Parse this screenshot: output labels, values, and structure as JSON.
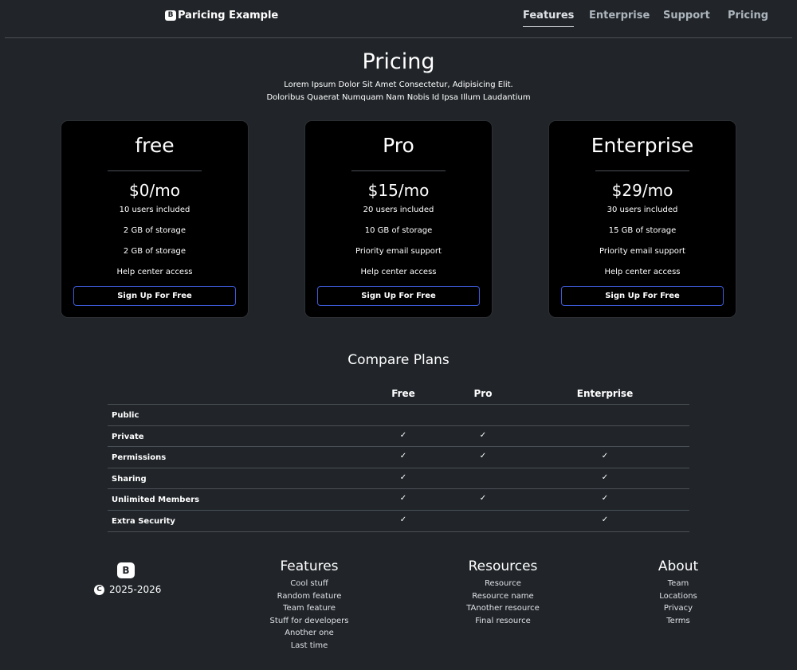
{
  "navbar": {
    "brand_logo": "B",
    "brand": "Paricing Example",
    "links": [
      {
        "label": "Features",
        "active": true
      },
      {
        "label": "Enterprise"
      },
      {
        "label": "Support"
      },
      {
        "label": "Pricing"
      }
    ]
  },
  "header": {
    "title": "Pricing",
    "subtitle_line1": "Lorem Ipsum Dolor Sit Amet Consectetur, Adipisicing Elit.",
    "subtitle_line2": "Doloribus Quaerat Numquam Nam Nobis Id Ipsa Illum Laudantium"
  },
  "plans": [
    {
      "name": "free",
      "price": "$0/mo",
      "features": [
        "10 users included",
        "2 GB of storage",
        "2 GB of storage",
        "Help center access"
      ],
      "button": "Sign Up For Free"
    },
    {
      "name": "Pro",
      "price": "$15/mo",
      "features": [
        "20 users included",
        "10 GB of storage",
        "Priority email support",
        "Help center access"
      ],
      "button": "Sign Up For Free"
    },
    {
      "name": "Enterprise",
      "price": "$29/mo",
      "features": [
        "30 users included",
        "15 GB of storage",
        "Priority email support",
        "Help center access"
      ],
      "button": "Sign Up For Free"
    }
  ],
  "compare": {
    "title": "Compare Plans",
    "columns": [
      "Free",
      "Pro",
      "Enterprise"
    ],
    "check_glyph": "✓",
    "rows": [
      {
        "label": "Public",
        "checks": [
          false,
          false,
          false
        ]
      },
      {
        "label": "Private",
        "checks": [
          true,
          true,
          false
        ]
      },
      {
        "label": "Permissions",
        "checks": [
          true,
          true,
          true
        ]
      },
      {
        "label": "Sharing",
        "checks": [
          true,
          false,
          true
        ]
      },
      {
        "label": "Unlimited Members",
        "checks": [
          true,
          true,
          true
        ]
      },
      {
        "label": "Extra Security",
        "checks": [
          true,
          false,
          true
        ]
      }
    ]
  },
  "footer": {
    "logo": "B",
    "copyright_symbol": "C",
    "years": "2025-2026",
    "columns": [
      {
        "title": "Features",
        "items": [
          "Cool stuff",
          "Random feature",
          "Team feature",
          "Stuff for developers",
          "Another one",
          "Last time"
        ]
      },
      {
        "title": "Resources",
        "items": [
          "Resource",
          "Resource name",
          "TAnother resource",
          "Final resource"
        ]
      },
      {
        "title": "About",
        "items": [
          "Team",
          "Locations",
          "Privacy",
          "Terms"
        ]
      }
    ]
  },
  "colors": {
    "background": "#212529",
    "card": "#000000",
    "button_border": "#3d5bd9"
  }
}
